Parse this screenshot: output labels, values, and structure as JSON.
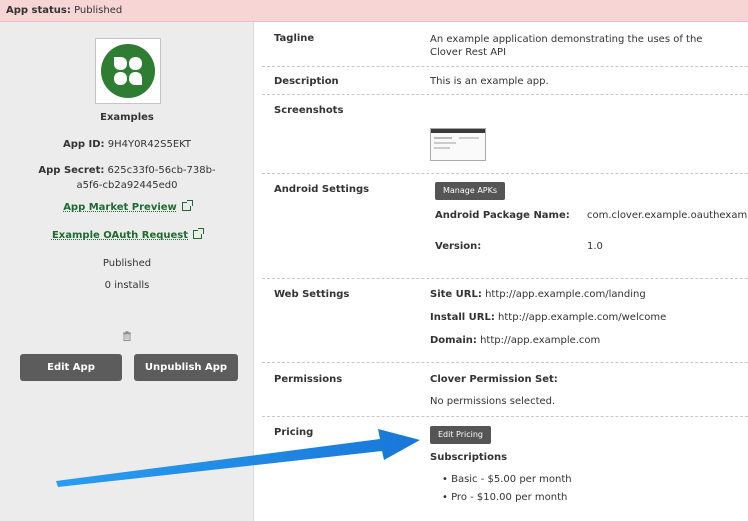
{
  "status": {
    "label": "App status:",
    "value": "Published"
  },
  "sidebar": {
    "app_name": "Examples",
    "app_id_label": "App ID:",
    "app_id": "9H4Y0R42S5EKT",
    "app_secret_label": "App Secret:",
    "app_secret": "625c33f0-56cb-738b-a5f6-cb2a92445ed0",
    "market_preview_link": "App Market Preview",
    "oauth_request_link": "Example OAuth Request",
    "published_text": "Published",
    "installs_text": "0 installs",
    "edit_button": "Edit App",
    "unpublish_button": "Unpublish App"
  },
  "details": {
    "tagline_label": "Tagline",
    "tagline_value": "An example application demonstrating the uses of the Clover Rest API",
    "description_label": "Description",
    "description_value": "This is an example app.",
    "screenshots_label": "Screenshots",
    "android_label": "Android Settings",
    "manage_apks_button": "Manage APKs",
    "android_package_label": "Android Package Name:",
    "android_package_value": "com.clover.example.oauthexample.",
    "version_label": "Version:",
    "version_value": "1.0",
    "web_label": "Web Settings",
    "site_url_label": "Site URL:",
    "site_url_value": "http://app.example.com/landing",
    "install_url_label": "Install URL:",
    "install_url_value": "http://app.example.com/welcome",
    "domain_label": "Domain:",
    "domain_value": "http://app.example.com",
    "permissions_label": "Permissions",
    "permission_set_label": "Clover Permission Set:",
    "permission_set_value": "No permissions selected.",
    "pricing_label": "Pricing",
    "edit_pricing_button": "Edit Pricing",
    "subscriptions_label": "Subscriptions",
    "subscriptions": [
      "Basic - $5.00 per month",
      "Pro - $10.00 per month"
    ]
  },
  "colors": {
    "status_bg": "#f7d5d5",
    "brand_green": "#2e7d32",
    "link_green": "#1d6b30",
    "arrow_blue": "#1e8fe8"
  }
}
